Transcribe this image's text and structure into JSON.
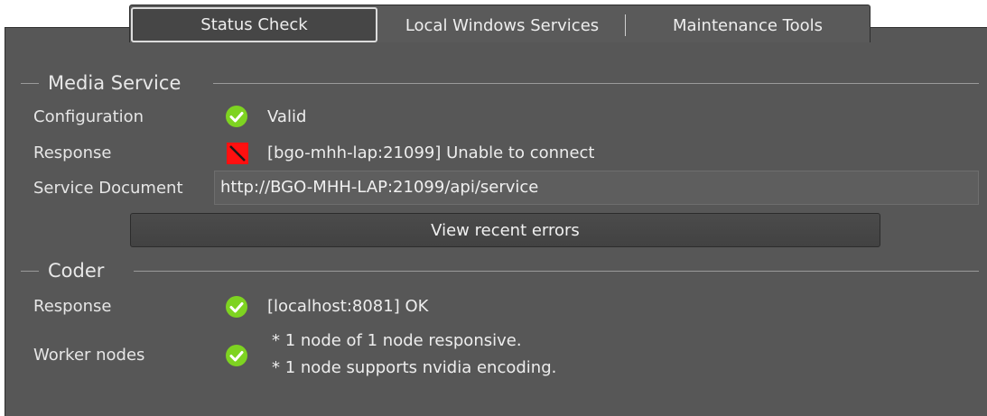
{
  "tabs": [
    {
      "label": "Status Check",
      "selected": true
    },
    {
      "label": "Local Windows Services",
      "selected": false
    },
    {
      "label": "Maintenance Tools",
      "selected": false
    }
  ],
  "media_service": {
    "title": "Media Service",
    "configuration": {
      "label": "Configuration",
      "status": "ok",
      "value": "Valid"
    },
    "response": {
      "label": "Response",
      "status": "error",
      "value": "[bgo-mhh-lap:21099] Unable to connect"
    },
    "service_document": {
      "label": "Service Document",
      "value": "http://BGO-MHH-LAP:21099/api/service"
    },
    "view_errors_button": "View recent errors"
  },
  "coder": {
    "title": "Coder",
    "response": {
      "label": "Response",
      "status": "ok",
      "value": "[localhost:8081] OK"
    },
    "worker_nodes": {
      "label": "Worker nodes",
      "status": "ok",
      "lines": [
        "* 1 node of 1 node responsive.",
        "* 1 node supports nvidia encoding."
      ]
    }
  },
  "colors": {
    "panel_bg": "#575757",
    "ok_green": "#7ed321",
    "error_red": "#ff1010",
    "text": "#e6e6e6"
  },
  "icons": {
    "ok": "check-circle-icon",
    "error": "error-square-icon"
  }
}
